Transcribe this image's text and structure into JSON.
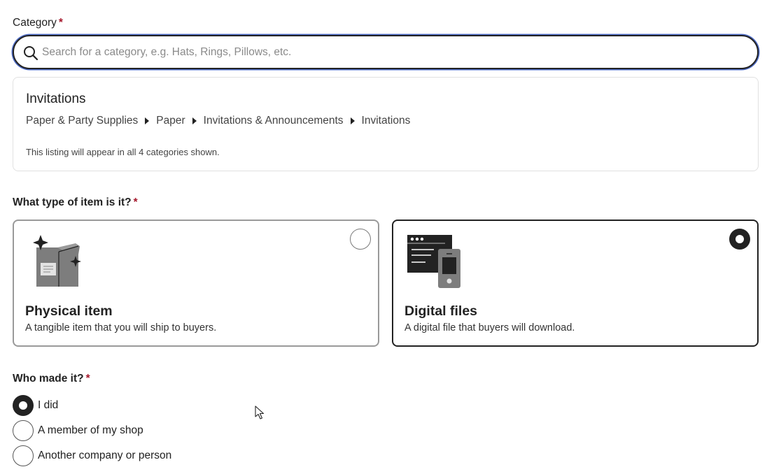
{
  "category": {
    "label": "Category",
    "required_mark": "*",
    "search": {
      "placeholder": "Search for a category, e.g. Hats, Rings, Pillows, etc.",
      "value": "",
      "icon": "search-icon"
    },
    "selected": {
      "title": "Invitations",
      "breadcrumb": [
        "Paper & Party Supplies",
        "Paper",
        "Invitations & Announcements",
        "Invitations"
      ],
      "note": "This listing will appear in all 4 categories shown."
    }
  },
  "item_type": {
    "label": "What type of item is it?",
    "required_mark": "*",
    "options": [
      {
        "title": "Physical item",
        "description": "A tangible item that you will ship to buyers.",
        "icon": "box-icon",
        "selected": false
      },
      {
        "title": "Digital files",
        "description": "A digital file that buyers will download.",
        "icon": "digital-files-icon",
        "selected": true
      }
    ]
  },
  "who_made": {
    "label": "Who made it?",
    "required_mark": "*",
    "options": [
      {
        "label": "I did",
        "selected": true
      },
      {
        "label": "A member of my shop",
        "selected": false
      },
      {
        "label": "Another company or person",
        "selected": false
      }
    ]
  },
  "colors": {
    "text": "#222222",
    "required": "#a61a2e",
    "focus_ring": "#4d6bc6",
    "border_light": "#e1e1e1",
    "border_unselected": "#9a9a9a"
  }
}
